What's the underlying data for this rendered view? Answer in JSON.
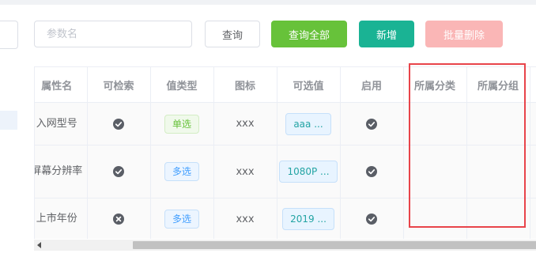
{
  "search": {
    "placeholder": "参数名",
    "value": ""
  },
  "toolbar": {
    "query_label": "查询",
    "query_all_label": "查询全部",
    "add_label": "新增",
    "batch_delete_label": "批量删除"
  },
  "table": {
    "headers": [
      "属性名",
      "可检索",
      "值类型",
      "图标",
      "可选值",
      "启用",
      "所属分类",
      "所属分组"
    ],
    "rows": [
      {
        "name": "入网型号",
        "searchable": "check-icon",
        "value_type": "单选",
        "icon": "xxx",
        "options": "aaa ...",
        "enabled": "check-icon",
        "category": "",
        "group": ""
      },
      {
        "name": "屏幕分辨率",
        "searchable": "check-icon",
        "value_type": "多选",
        "icon": "xxx",
        "options": "1080P ...",
        "enabled": "check-icon",
        "category": "",
        "group": ""
      },
      {
        "name": "上市年份",
        "searchable": "close-icon",
        "value_type": "多选",
        "icon": "xxx",
        "options": "2019 ...",
        "enabled": "check-icon",
        "category": "",
        "group": ""
      }
    ]
  },
  "colors": {
    "success": "#67c23a",
    "teal": "#1ab394",
    "danger_light": "#fab6b6",
    "highlight": "#e8444a"
  }
}
